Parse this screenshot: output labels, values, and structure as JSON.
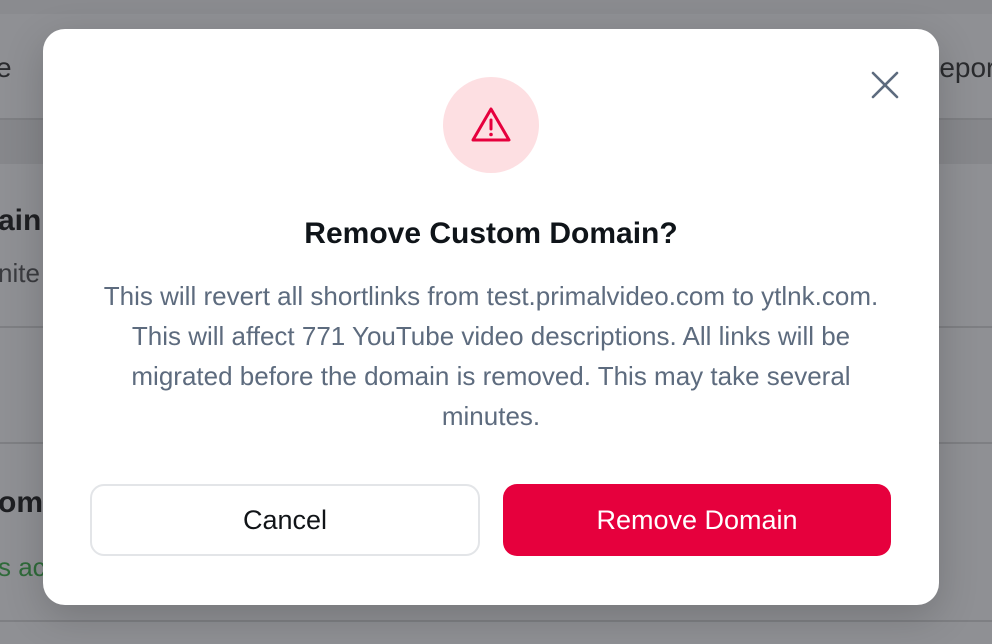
{
  "background": {
    "fragments": [
      "e",
      "report",
      "ain",
      "nite",
      "om",
      "s ac"
    ]
  },
  "modal": {
    "title": "Remove Custom Domain?",
    "message": "This will revert all shortlinks from test.primalvideo.com to ytlnk.com. This will affect 771 YouTube video descriptions. All links will be migrated before the domain is removed. This may take several minutes.",
    "cancel_label": "Cancel",
    "confirm_label": "Remove Domain",
    "icons": {
      "warning": "warning-triangle-icon",
      "close": "close-icon"
    }
  },
  "colors": {
    "danger": "#e6003d",
    "danger_soft": "#fddfe2",
    "text_muted": "#5d6b7e",
    "bg_green_text": "#2f6b3a"
  }
}
